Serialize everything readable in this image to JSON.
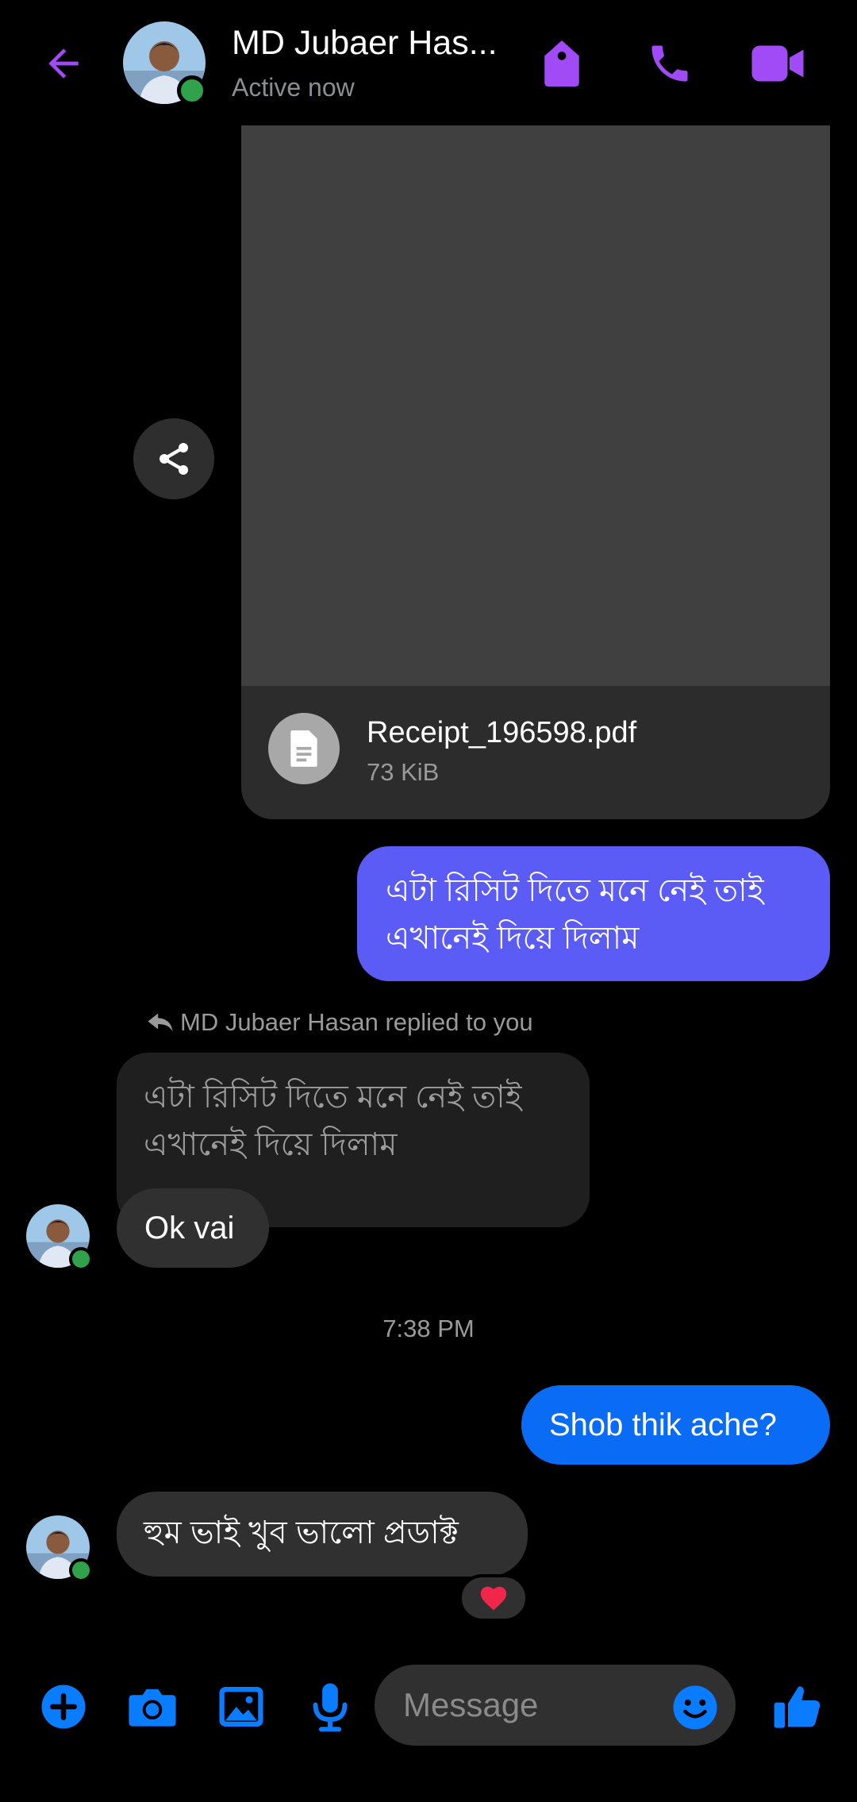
{
  "header": {
    "contact_name": "MD Jubaer Has...",
    "status": "Active now",
    "icons": [
      "back-arrow-icon",
      "tag-icon",
      "phone-icon",
      "video-camera-icon"
    ],
    "accent_color": "#a04bf5"
  },
  "attachment": {
    "file_name": "Receipt_196598.pdf",
    "file_size": "73 KiB"
  },
  "messages": {
    "outgoing_1": "এটা রিসিট দিতে মনে নেই তাই এখানেই দিয়ে দিলাম",
    "reply_label": "MD Jubaer Hasan replied to you",
    "quoted_text": "এটা রিসিট দিতে মনে নেই তাই এখানেই দিয়ে দিলাম",
    "incoming_1": "Ok vai",
    "timestamp": "7:38 PM",
    "outgoing_2": "Shob thik ache?",
    "incoming_2": "হুম  ভাই খুব ভালো প্রডাক্ট",
    "reaction": "heart"
  },
  "composer": {
    "placeholder": "Message",
    "icons": [
      "plus-icon",
      "camera-icon",
      "gallery-icon",
      "microphone-icon",
      "emoji-icon",
      "thumbs-up-icon"
    ],
    "accent_color": "#0a7cff"
  },
  "colors": {
    "outgoing_purple": "#5b5bf5",
    "outgoing_blue": "#0a6cf5",
    "incoming_bubble": "#303030",
    "online": "#31a24c"
  }
}
